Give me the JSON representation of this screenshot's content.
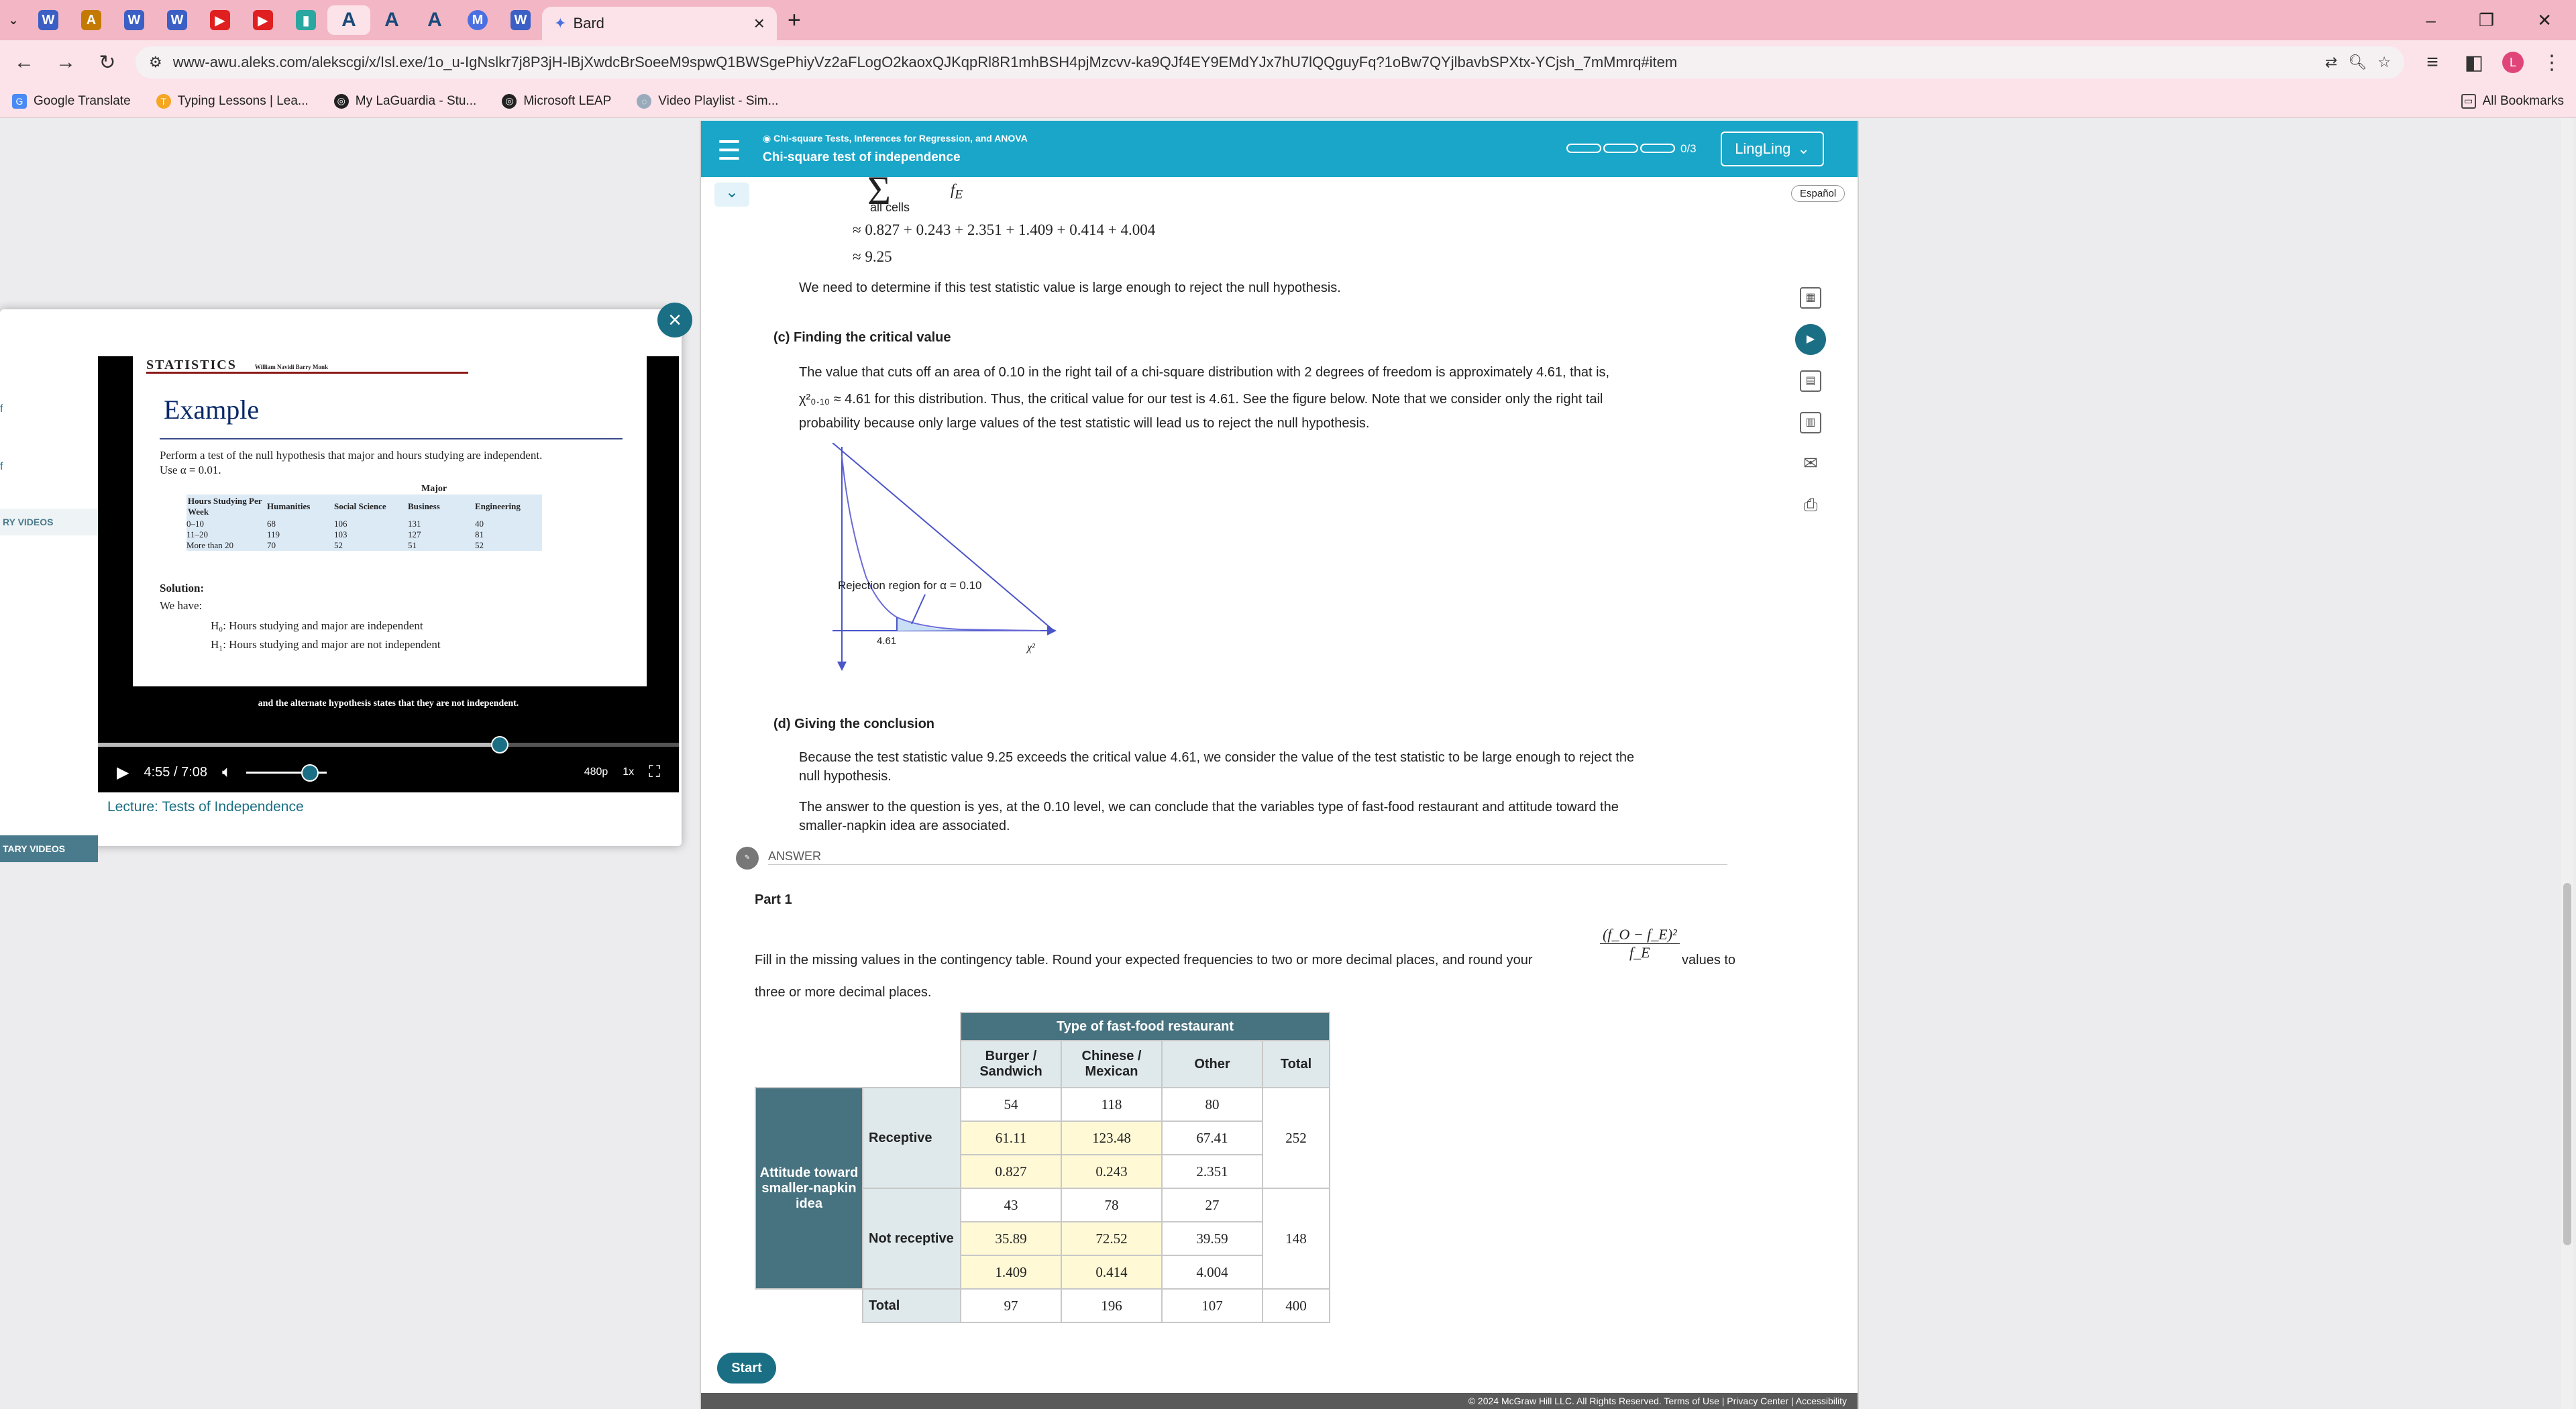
{
  "browser": {
    "tabs": [
      "W",
      "A",
      "W",
      "W",
      "▶",
      "▶",
      "▮",
      "A",
      "A",
      "A",
      "M",
      "W"
    ],
    "active_tab_title": "Bard",
    "url": "www-awu.aleks.com/alekscgi/x/Isl.exe/1o_u-IgNslkr7j8P3jH-lBjXwdcBrSoeeM9spwQ1BWSgePhiyVz2aFLogO2kaoxQJKqpRl8R1mhBSH4pjMzcvv-ka9QJf4EY9EMdYJx7hU7lQQguyFq?1oBw7QYjlbavbSPXtx-YCjsh_7mMmrq#item",
    "profile_initial": "L",
    "bookmarks": [
      "Google Translate",
      "Typing Lessons | Lea...",
      "My LaGuardia - Stu...",
      "Microsoft LEAP",
      "Video Playlist - Sim..."
    ],
    "all_bookmarks": "All Bookmarks"
  },
  "aleks": {
    "topic_sub": "Chi-square Tests, Inferences for Regression, and ANOVA",
    "topic_title": "Chi-square test of independence",
    "progress": "0/3",
    "user": "LingLing",
    "espanol": "Español",
    "sum_label": "all cells",
    "fe": "f",
    "fe_sub": "E",
    "eq1": "≈ 0.827 + 0.243 + 2.351 + 1.409 + 0.414 + 4.004",
    "eq2": "≈ 9.25",
    "t1": "We need to determine if this test statistic value is large enough to reject the null hypothesis.",
    "c_title": "(c) Finding the critical value",
    "c_line1": "The value that cuts off an area of 0.10 in the right tail of a chi-square distribution with 2 degrees of freedom is approximately 4.61, that is,",
    "c_line2": "χ²₀.₁₀ ≈ 4.61 for this distribution. Thus, the critical value for our test is 4.61. See the figure below. Note that we consider only the right tail",
    "c_line3": "probability because only large values of the test statistic will lead us to reject the null hypothesis.",
    "graph_label": "Rejection region for α = 0.10",
    "graph_tick": "4.61",
    "graph_x": "χ²",
    "d_title": "(d) Giving the conclusion",
    "d_line1": "Because the test statistic value 9.25 exceeds the critical value 4.61, we consider the value of the test statistic to be large enough to reject the",
    "d_line2": "null hypothesis.",
    "d_line3": "The answer to the question is yes, at the 0.10 level, we can conclude that the variables type of fast-food restaurant and attitude toward the",
    "d_line4": "smaller-napkin idea are associated.",
    "answer": "ANSWER",
    "part": "Part 1",
    "instr1": "Fill in the missing values in the contingency table. Round your expected frequencies to two or more decimal places, and round your",
    "frac_num": "(f_O − f_E)²",
    "frac_den": "f_E",
    "instr2": "values to",
    "instr3": "three or more decimal places.",
    "table": {
      "col_group": "Type of fast-food restaurant",
      "cols": [
        "Burger / Sandwich",
        "Chinese / Mexican",
        "Other",
        "Total"
      ],
      "row_group": "Attitude toward smaller-napkin idea",
      "rows": [
        {
          "label": "Receptive",
          "obs": [
            "54",
            "118",
            "80"
          ],
          "exp": [
            "61.11",
            "123.48",
            "67.41"
          ],
          "chi": [
            "0.827",
            "0.243",
            "2.351"
          ],
          "total": "252"
        },
        {
          "label": "Not receptive",
          "obs": [
            "43",
            "78",
            "27"
          ],
          "exp": [
            "35.89",
            "72.52",
            "39.59"
          ],
          "chi": [
            "1.409",
            "0.414",
            "4.004"
          ],
          "total": "148"
        }
      ],
      "total_label": "Total",
      "totals": [
        "97",
        "196",
        "107",
        "400"
      ]
    },
    "start": "Start",
    "footer": "© 2024 McGraw Hill LLC. All Rights Reserved.   Terms of Use  |  Privacy Center  |  Accessibility"
  },
  "video_panel": {
    "side_labels": [
      "f",
      "f",
      "RY VIDEOS",
      "TARY VIDEOS"
    ],
    "slide_header": "STATISTICS",
    "slide_authors": "William Navidi   Barry Monk",
    "slide_title": "Example",
    "slide_text1": "Perform a test of the null hypothesis that major and hours studying are independent.",
    "slide_text2": "Use α = 0.01.",
    "slide_table_head": [
      "Hours Studying Per Week",
      "Humanities",
      "Social Science",
      "Business",
      "Engineering"
    ],
    "slide_major": "Major",
    "slide_rows": [
      [
        "0–10",
        "68",
        "106",
        "131",
        "40"
      ],
      [
        "11–20",
        "119",
        "103",
        "127",
        "81"
      ],
      [
        "More than 20",
        "70",
        "52",
        "51",
        "52"
      ]
    ],
    "slide_solution": "Solution:",
    "slide_we_have": "We have:",
    "h0": "H₀: Hours studying and major are independent",
    "h1": "H₁: Hours studying and major are not independent",
    "caption": "and the alternate hypothesis states that they are not independent.",
    "time": "4:55 / 7:08",
    "quality": "480p",
    "speed": "1x",
    "lecture_title": "Lecture: Tests of Independence"
  }
}
